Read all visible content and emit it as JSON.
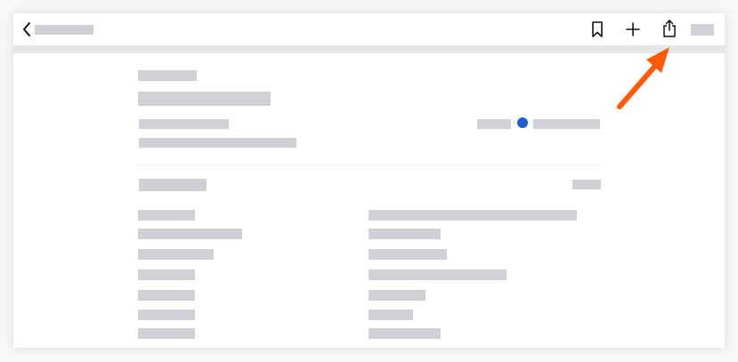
{
  "toolbar": {
    "back_icon": "chevron-left-icon",
    "bookmark_icon": "bookmark-icon",
    "add_icon": "plus-icon",
    "share_icon": "share-icon"
  },
  "annotation": {
    "arrow_color": "#ff5a0a",
    "points_to": "share-button"
  },
  "colors": {
    "skeleton": "#d0d0d6",
    "status_dot": "#1f5fcc",
    "toolbar_divider": "#e5e6ea"
  }
}
